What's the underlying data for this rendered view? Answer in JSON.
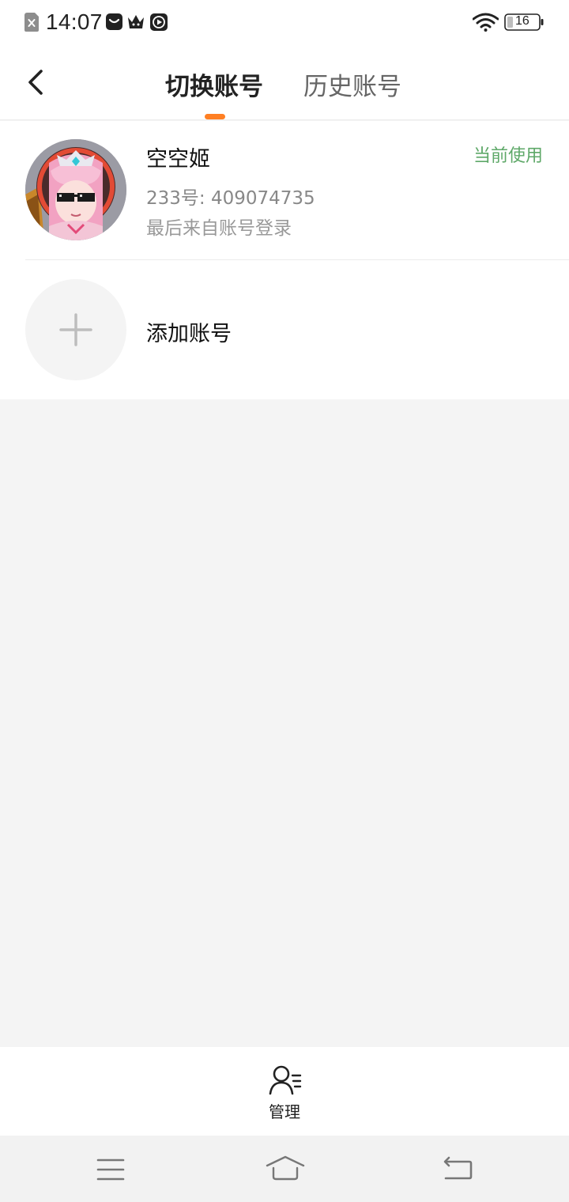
{
  "status_bar": {
    "time": "14:07",
    "battery": "16",
    "icons": [
      "sim-off-icon",
      "message-icon",
      "crown-icon",
      "play-icon",
      "wifi-icon",
      "battery-icon"
    ]
  },
  "header": {
    "back_icon": "chevron-left-icon",
    "tabs": [
      {
        "label": "切换账号",
        "active": true
      },
      {
        "label": "历史账号",
        "active": false
      }
    ],
    "accent_color": "#ff7f23"
  },
  "accounts": [
    {
      "name": "空空姬",
      "id_text": "233号: 409074735",
      "source": "最后来自账号登录",
      "status": "当前使用",
      "status_color": "#5ea868"
    }
  ],
  "add_account": {
    "label": "添加账号",
    "icon": "plus-icon"
  },
  "bottom_bar": {
    "manage_label": "管理",
    "manage_icon": "user-list-icon"
  },
  "nav_bar": {
    "icons": [
      "menu-icon",
      "home-icon",
      "back-icon"
    ]
  }
}
